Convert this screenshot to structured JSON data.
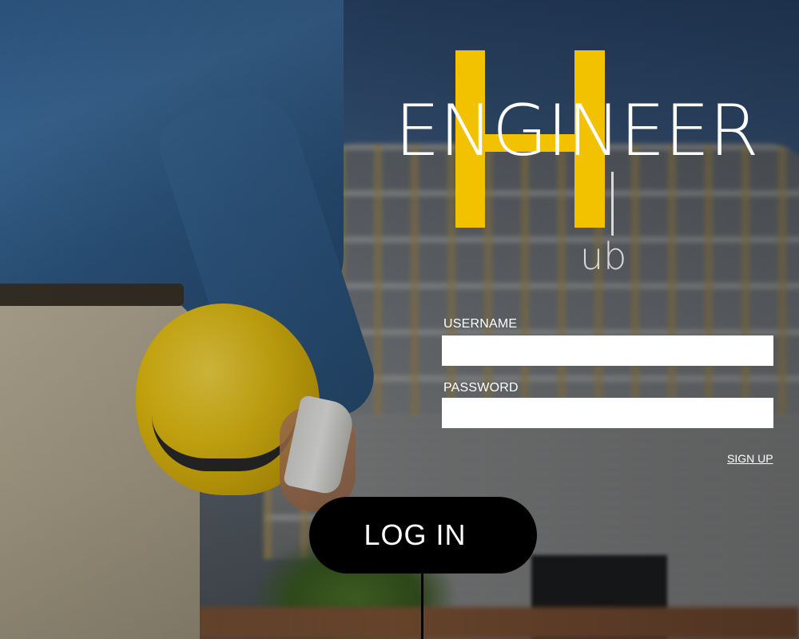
{
  "logo": {
    "word": "ENGINEER",
    "sub": "ub",
    "accent_color": "#f2c200"
  },
  "form": {
    "username_label": "USERNAME",
    "username_value": "",
    "password_label": "PASSWORD",
    "password_value": "",
    "signup_link": "SIGN UP",
    "login_button": "LOG IN"
  }
}
